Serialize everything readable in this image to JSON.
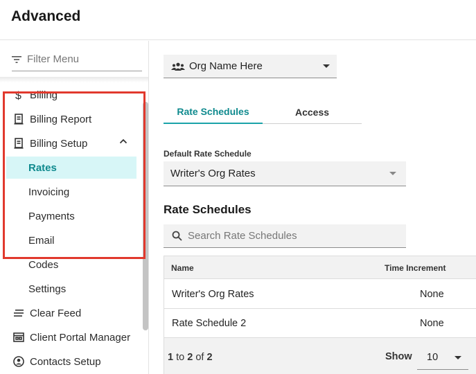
{
  "header": {
    "title": "Advanced"
  },
  "sidebar": {
    "filter_placeholder": "Filter Menu",
    "items": [
      {
        "label": "Billing",
        "icon": "dollar-icon"
      },
      {
        "label": "Billing Report",
        "icon": "report-icon"
      },
      {
        "label": "Billing Setup",
        "icon": "receipt-icon",
        "expanded": true
      },
      {
        "label": "Rates",
        "active": true
      },
      {
        "label": "Invoicing"
      },
      {
        "label": "Payments"
      },
      {
        "label": "Email"
      },
      {
        "label": "Codes"
      },
      {
        "label": "Settings"
      },
      {
        "label": "Clear Feed",
        "icon": "feed-icon"
      },
      {
        "label": "Client Portal Manager",
        "icon": "portal-icon"
      },
      {
        "label": "Contacts Setup",
        "icon": "contact-icon"
      }
    ]
  },
  "main": {
    "org_select": {
      "value": "Org Name Here",
      "icon": "group-icon"
    },
    "tabs": [
      {
        "label": "Rate Schedules",
        "active": true
      },
      {
        "label": "Access"
      }
    ],
    "default_rate": {
      "label": "Default Rate Schedule",
      "value": "Writer's Org Rates"
    },
    "section_title": "Rate Schedules",
    "search": {
      "placeholder": "Search Rate Schedules"
    },
    "table": {
      "columns": [
        "Name",
        "Time Increment"
      ],
      "rows": [
        {
          "name": "Writer's Org Rates",
          "increment": "None"
        },
        {
          "name": "Rate Schedule 2",
          "increment": "None"
        }
      ],
      "pagination": {
        "from": "1",
        "to_word": "to",
        "to": "2",
        "of_word": "of",
        "total": "2"
      },
      "show_label": "Show",
      "page_size": "10"
    }
  },
  "colors": {
    "accent": "#0f8a8e",
    "active_bg": "#d7f6f7",
    "highlight_border": "#e1392d"
  }
}
